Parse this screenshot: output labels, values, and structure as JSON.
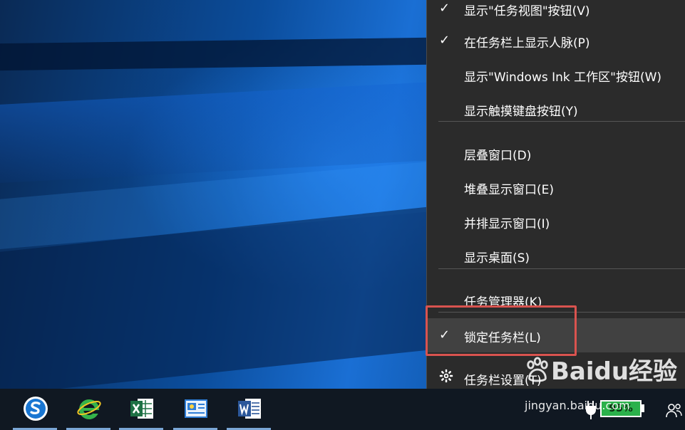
{
  "menu": {
    "items": [
      {
        "label": "显示\"任务视图\"按钮(V)",
        "checked": true
      },
      {
        "label": "在任务栏上显示人脉(P)",
        "checked": true
      },
      {
        "label": "显示\"Windows Ink 工作区\"按钮(W)",
        "checked": false
      },
      {
        "label": "显示触摸键盘按钮(Y)",
        "checked": false
      },
      {
        "label": "层叠窗口(D)",
        "checked": false
      },
      {
        "label": "堆叠显示窗口(E)",
        "checked": false
      },
      {
        "label": "并排显示窗口(I)",
        "checked": false
      },
      {
        "label": "显示桌面(S)",
        "checked": false
      },
      {
        "label": "任务管理器(K)",
        "checked": false
      },
      {
        "label": "锁定任务栏(L)",
        "checked": true
      },
      {
        "label": "任务栏设置(T)",
        "checked": false
      }
    ],
    "check_glyph": "✓"
  },
  "taskbar": {
    "apps": [
      "sogou-browser-icon",
      "ie-browser-icon",
      "excel-icon",
      "onenote-icon",
      "word-icon"
    ]
  },
  "tray": {
    "battery_percent": "95%",
    "battery_level": 0.95
  },
  "watermark": {
    "text": "Baidu经验",
    "url": "jingyan.baidu.com"
  },
  "colors": {
    "menu_bg": "#2b2b2b",
    "highlight_border": "#d9534f",
    "battery_green": "#2bb14b"
  }
}
